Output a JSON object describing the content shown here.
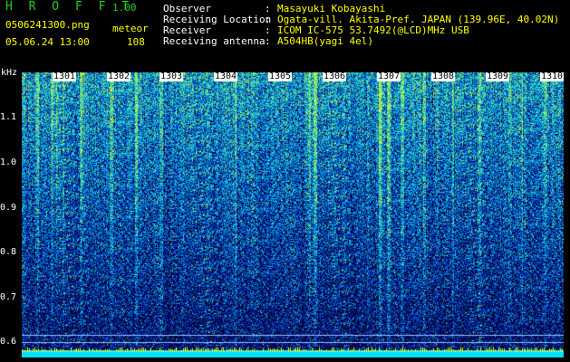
{
  "app": {
    "title": "H R O F F T",
    "version": "1.00"
  },
  "file": {
    "name": "0506241300.png",
    "mode": "meteor",
    "datetime": "05.06.24 13:00",
    "count": "108"
  },
  "info": [
    {
      "label": "Observer",
      "value": "Masayuki Kobayashi"
    },
    {
      "label": "Receiving Location",
      "value": "Ogata-vill. Akita-Pref. JAPAN (139.96E, 40.02N)"
    },
    {
      "label": "Receiver",
      "value": "ICOM IC-575 53.7492(@LCD)MHz USB"
    },
    {
      "label": "Receiving antenna",
      "value": "A504HB(yagi 4el)"
    }
  ],
  "separator": ":",
  "spectrogram": {
    "y_unit": "kHz",
    "y_ticks": [
      "1.1",
      "1.0",
      "0.9",
      "0.8",
      "0.7",
      "0.6"
    ],
    "time_labels": [
      "1301",
      "1302",
      "1303",
      "1304",
      "1305",
      "1306",
      "1307",
      "1308",
      "1309",
      "1310"
    ],
    "colors": {
      "background": "#000000",
      "label_green": "#1fd21f",
      "label_yellow": "#ffff00",
      "baseline_cyan": "#00e0ff"
    }
  }
}
